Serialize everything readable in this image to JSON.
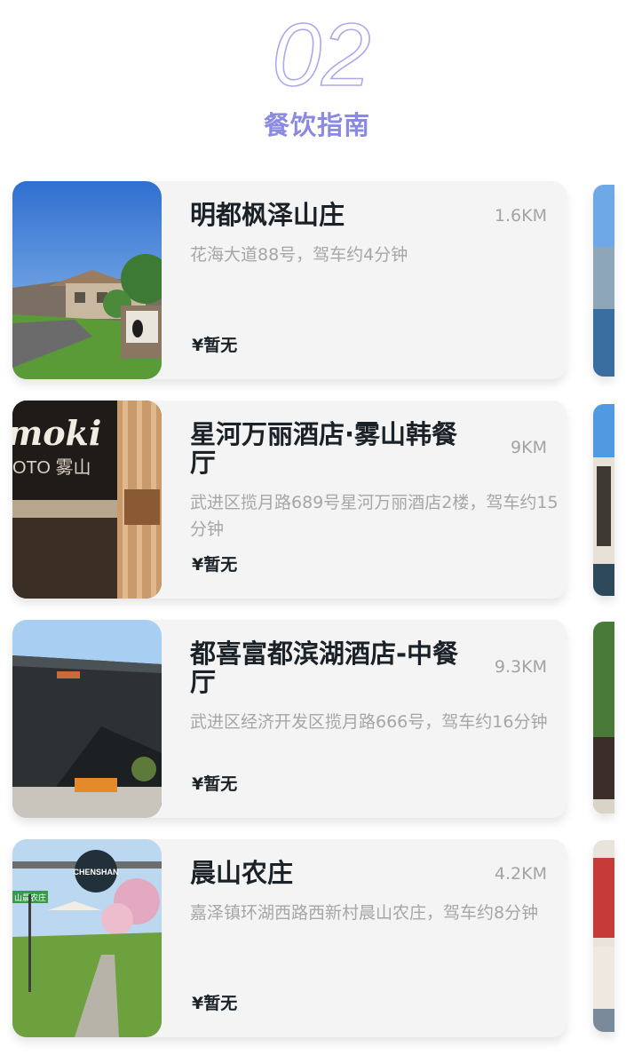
{
  "section": {
    "number": "02",
    "title": "餐饮指南"
  },
  "restaurants": [
    {
      "name": "明都枫泽山庄",
      "distance": "1.6KM",
      "address": "花海大道88号，驾车约4分钟",
      "price": "¥暂无"
    },
    {
      "name": "星河万丽酒店·雾山韩餐厅",
      "distance": "9KM",
      "address": "武进区揽月路689号星河万丽酒店2楼，驾车约15分钟",
      "price": "¥暂无"
    },
    {
      "name": "都喜富都滨湖酒店-中餐厅",
      "distance": "9.3KM",
      "address": "武进区经济开发区揽月路666号，驾车约16分钟",
      "price": "¥暂无"
    },
    {
      "name": "晨山农庄",
      "distance": "4.2KM",
      "address": "嘉泽镇环湖西路西新村晨山农庄，驾车约8分钟",
      "price": "¥暂无"
    }
  ],
  "photo_signs": {
    "restaurant2": "moki",
    "restaurant2_sub": "OTO 雾山",
    "restaurant4": "CHENSHAN",
    "restaurant4_green": "山晨农庄"
  },
  "colors": {
    "accent": "#8a8ae0",
    "card": "#f4f4f4",
    "text": "#1a2228",
    "muted": "#a6a6a6"
  }
}
